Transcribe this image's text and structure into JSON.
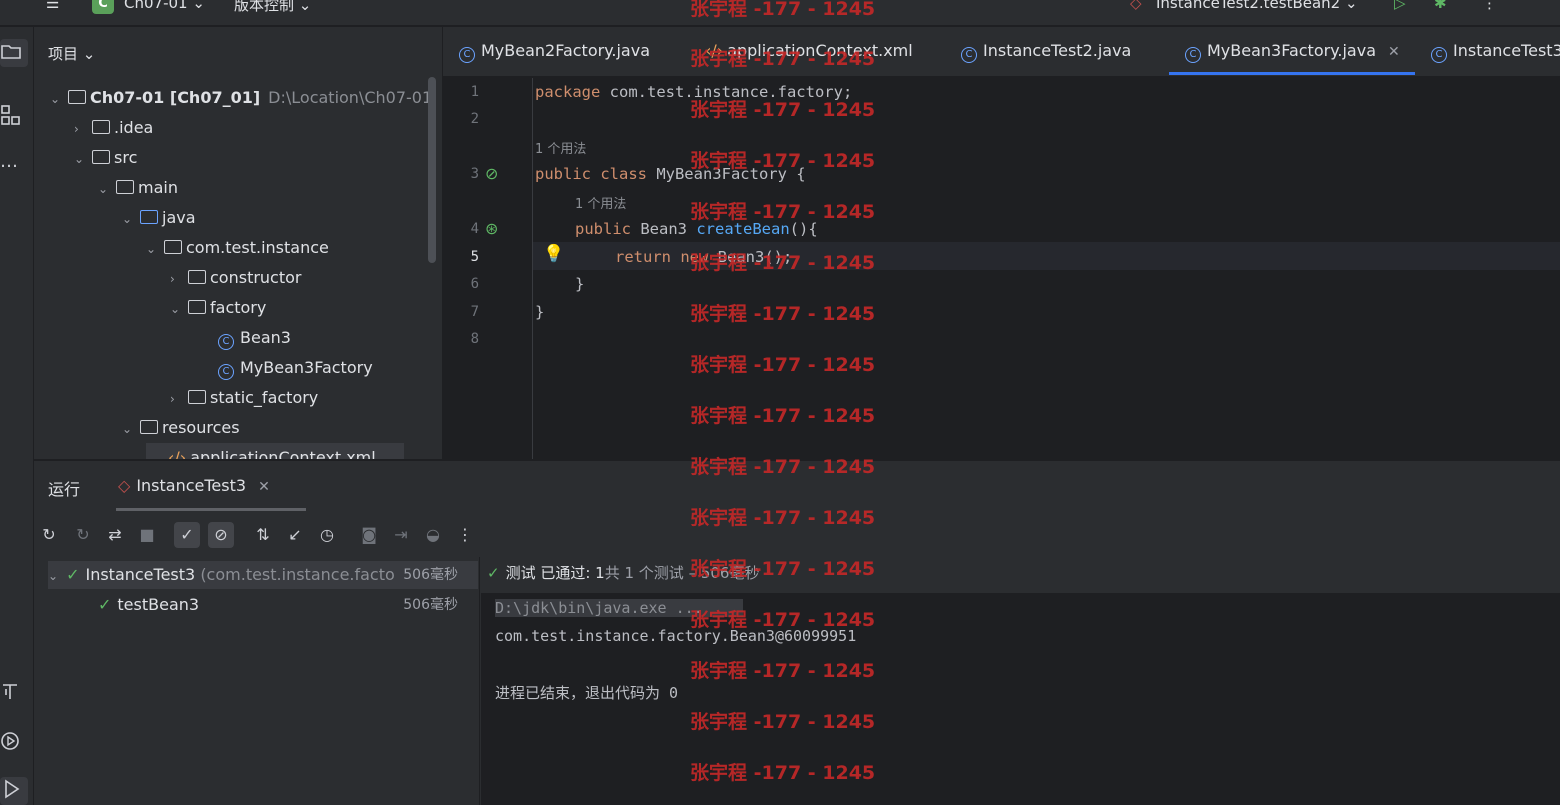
{
  "titlebar": {
    "project_badge": "C",
    "project_name": "Ch07-01",
    "vcs": "版本控制",
    "run_config": "InstanceTest2.testBean2"
  },
  "project": {
    "header": "项目",
    "items": [
      {
        "label": "Ch07-01 [Ch07_01]",
        "hint": "D:\\Location\\Ch07-01"
      },
      {
        "label": ".idea"
      },
      {
        "label": "src"
      },
      {
        "label": "main"
      },
      {
        "label": "java"
      },
      {
        "label": "com.test.instance"
      },
      {
        "label": "constructor"
      },
      {
        "label": "factory"
      },
      {
        "label": "Bean3"
      },
      {
        "label": "MyBean3Factory"
      },
      {
        "label": "static_factory"
      },
      {
        "label": "resources"
      },
      {
        "label": "applicationContext.xml"
      }
    ]
  },
  "editor_tabs": [
    {
      "label": "MyBean2Factory.java"
    },
    {
      "label": "applicationContext.xml"
    },
    {
      "label": "InstanceTest2.java"
    },
    {
      "label": "MyBean3Factory.java",
      "active": true
    },
    {
      "label": "InstanceTest3"
    }
  ],
  "editor": {
    "line_numbers": [
      "1",
      "2",
      "3",
      "4",
      "5",
      "6",
      "7",
      "8"
    ],
    "usage_hint": "1 个用法",
    "code": {
      "l1_kw": "package",
      "l1_rest": " com.test.instance.factory;",
      "l3_kw": "public class",
      "l3_rest": " MyBean3Factory {",
      "l4_kw": "public",
      "l4_type": " Bean3 ",
      "l4_fn": "createBean",
      "l4_rest": "(){",
      "l5_kw": "return new",
      "l5_rest": " Bean3();",
      "l6": "}",
      "l7": "}"
    }
  },
  "run": {
    "label": "运行",
    "tab": "InstanceTest3",
    "tests": [
      {
        "name": "InstanceTest3",
        "pkg": "(com.test.instance.facto",
        "duration": "506毫秒"
      },
      {
        "name": "testBean3",
        "duration": "506毫秒"
      }
    ],
    "status": "测试 已通过: 1",
    "status_detail": "共 1 个测试 – 506毫秒",
    "console": [
      "D:\\jdk\\bin\\java.exe ...",
      "com.test.instance.factory.Bean3@60099951",
      "",
      "进程已结束，退出代码为 0"
    ]
  },
  "watermark": "张宇程 -177 - 1245"
}
